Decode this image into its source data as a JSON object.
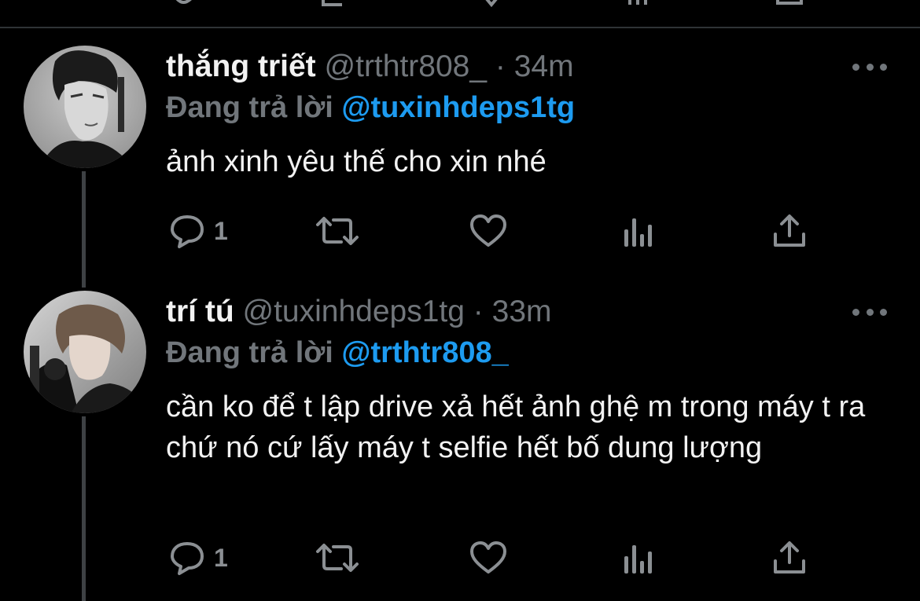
{
  "colors": {
    "background": "#000000",
    "text": "#e7e9ea",
    "muted": "#71767b",
    "accent": "#1d9bf0",
    "divider": "#2f3336"
  },
  "tweets": [
    {
      "display_name": "thắng triết",
      "handle": "@trthtr808_",
      "separator": "·",
      "time": "34m",
      "reply_prefix": "Đang trả lời",
      "reply_to": "@tuxinhdeps1tg",
      "text": "ảnh xinh yêu thế cho xin nhé",
      "reply_count": "1",
      "avatar": "avatar-photo"
    },
    {
      "display_name": "trí tú",
      "handle": "@tuxinhdeps1tg",
      "separator": "·",
      "time": "33m",
      "reply_prefix": "Đang trả lời",
      "reply_to": "@trthtr808_",
      "text": "cần ko để t lập drive xả hết ảnh ghệ m trong máy t ra chứ nó cứ lấy máy t selfie hết bố dung lượng",
      "reply_count": "1",
      "avatar": "avatar-photo"
    }
  ],
  "icons": [
    "reply-icon",
    "retweet-icon",
    "like-icon",
    "analytics-icon",
    "share-icon",
    "more-icon"
  ]
}
